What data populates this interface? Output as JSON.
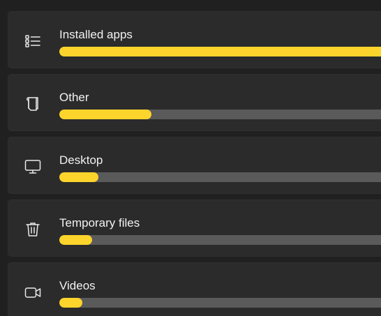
{
  "colors": {
    "background": "#202020",
    "card": "#2b2b2b",
    "usage_fill": "#fcd42b",
    "track": "#5a5a5a",
    "text": "#f2f2f2"
  },
  "storage_categories": [
    {
      "label": "Installed apps",
      "icon": "list-icon",
      "usage_fraction": 0.99
    },
    {
      "label": "Other",
      "icon": "document-icon",
      "usage_fraction": 0.28
    },
    {
      "label": "Desktop",
      "icon": "monitor-icon",
      "usage_fraction": 0.12
    },
    {
      "label": "Temporary files",
      "icon": "trash-icon",
      "usage_fraction": 0.1
    },
    {
      "label": "Videos",
      "icon": "video-camera-icon",
      "usage_fraction": 0.07
    }
  ]
}
